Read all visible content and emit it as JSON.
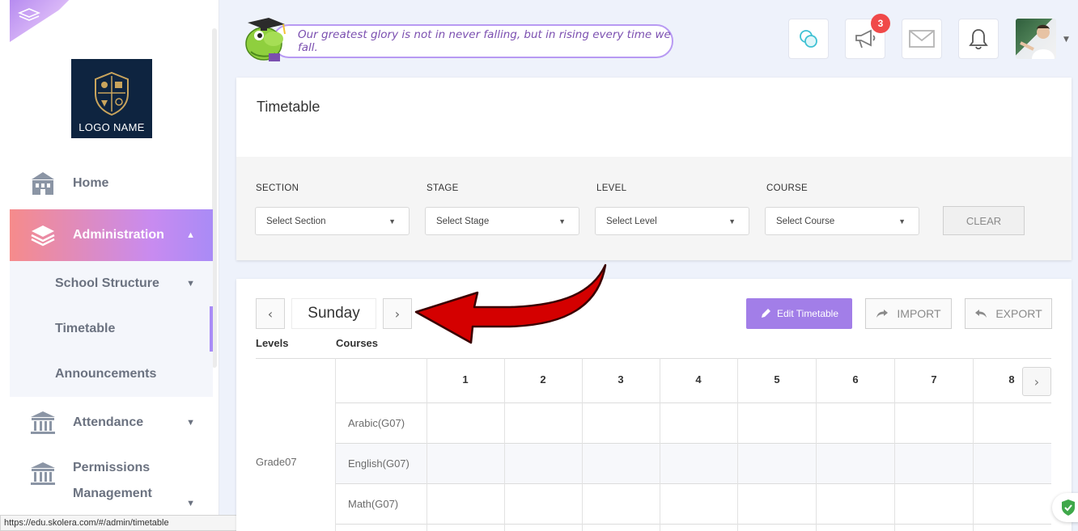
{
  "sidebar": {
    "logo_text": "LOGO NAME",
    "items": [
      {
        "label": "Home",
        "icon": "building-icon"
      },
      {
        "label": "Administration",
        "icon": "layers-icon",
        "active": true
      },
      {
        "label": "School Structure"
      },
      {
        "label": "Timetable"
      },
      {
        "label": "Announcements"
      },
      {
        "label": "Attendance",
        "icon": "institution-icon"
      },
      {
        "label": "Permissions",
        "label2": "Management",
        "icon": "institution-icon"
      }
    ]
  },
  "status_url": "https://edu.skolera.com/#/admin/timetable",
  "header": {
    "quote": "Our greatest glory is not in never falling, but in rising every time we fall.",
    "notification_count": "3"
  },
  "filters": {
    "title": "Timetable",
    "section_label": "SECTION",
    "stage_label": "STAGE",
    "level_label": "LEVEL",
    "course_label": "COURSE",
    "section_value": "Select Section",
    "stage_value": "Select Stage",
    "level_value": "Select Level",
    "course_value": "Select Course",
    "clear_label": "CLEAR"
  },
  "timetable": {
    "day": "Sunday",
    "edit_label": "Edit Timetable",
    "import_label": "IMPORT",
    "export_label": "EXPORT",
    "levels_header": "Levels",
    "courses_header": "Courses",
    "periods": [
      "1",
      "2",
      "3",
      "4",
      "5",
      "6",
      "7",
      "8"
    ],
    "level": "Grade07",
    "courses": [
      "Arabic(G07)",
      "English(G07)",
      "Math(G07)"
    ]
  },
  "colors": {
    "accent": "#a27ee8",
    "active_gradient_start": "#f68b8b",
    "active_gradient_end": "#a98bf6",
    "badge": "#f04949",
    "annotation_arrow": "#d40000"
  }
}
